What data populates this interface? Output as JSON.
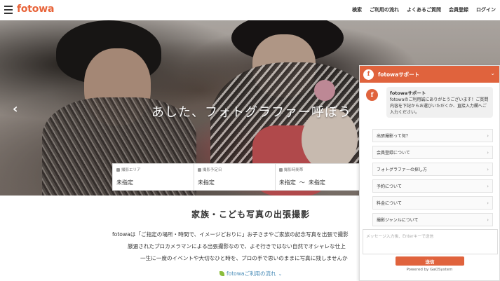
{
  "header": {
    "logo": "fotowa",
    "nav": [
      "検索",
      "ご利用の流れ",
      "よくあるご質問",
      "会員登録",
      "ログイン"
    ]
  },
  "hero": {
    "title": "あした、フォトグラファー呼ぼう",
    "search": {
      "area_label": "撮影エリア",
      "area_value": "未指定",
      "date_label": "撮影予定日",
      "date_value": "未指定",
      "time_label": "撮影時間帯",
      "time_from": "未指定",
      "time_sep": "〜",
      "time_to": "未指定"
    }
  },
  "main": {
    "section_title": "家族・こども写真の出張撮影",
    "desc": [
      "fotowaは「ご指定の場所・時間で、イメージどおりに」お子さまやご家族の記念写真を出張で撮影",
      "厳選されたプロカメラマンによる出張撮影なので、よそ行きではない自然でオシャレな仕上",
      "一生に一度のイベントや大切なひと時を、プロの手で思いのままに写真に残しませんか"
    ],
    "flow_link": "fotowaご利用の流れ"
  },
  "chat": {
    "header_title": "fotowaサポート",
    "sender": "fotowaサポート",
    "message": "fotowaのご利用誠にありがとうございます！ご質問内容を下記からお選びいただくか、直接入力欄へご入力ください。",
    "options": [
      "出張撮影って何？",
      "会員登録について",
      "フォトグラファーの探し方",
      "予約について",
      "料金について",
      "撮影ジャンルについて"
    ],
    "input_placeholder": "メッセージ入力後、Enterキーで送信",
    "send_label": "送信",
    "powered_by": "Powered by GaOSystem"
  },
  "colors": {
    "brand": "#e8643a",
    "chat_accent": "#e0633d",
    "link": "#4a8db8"
  }
}
